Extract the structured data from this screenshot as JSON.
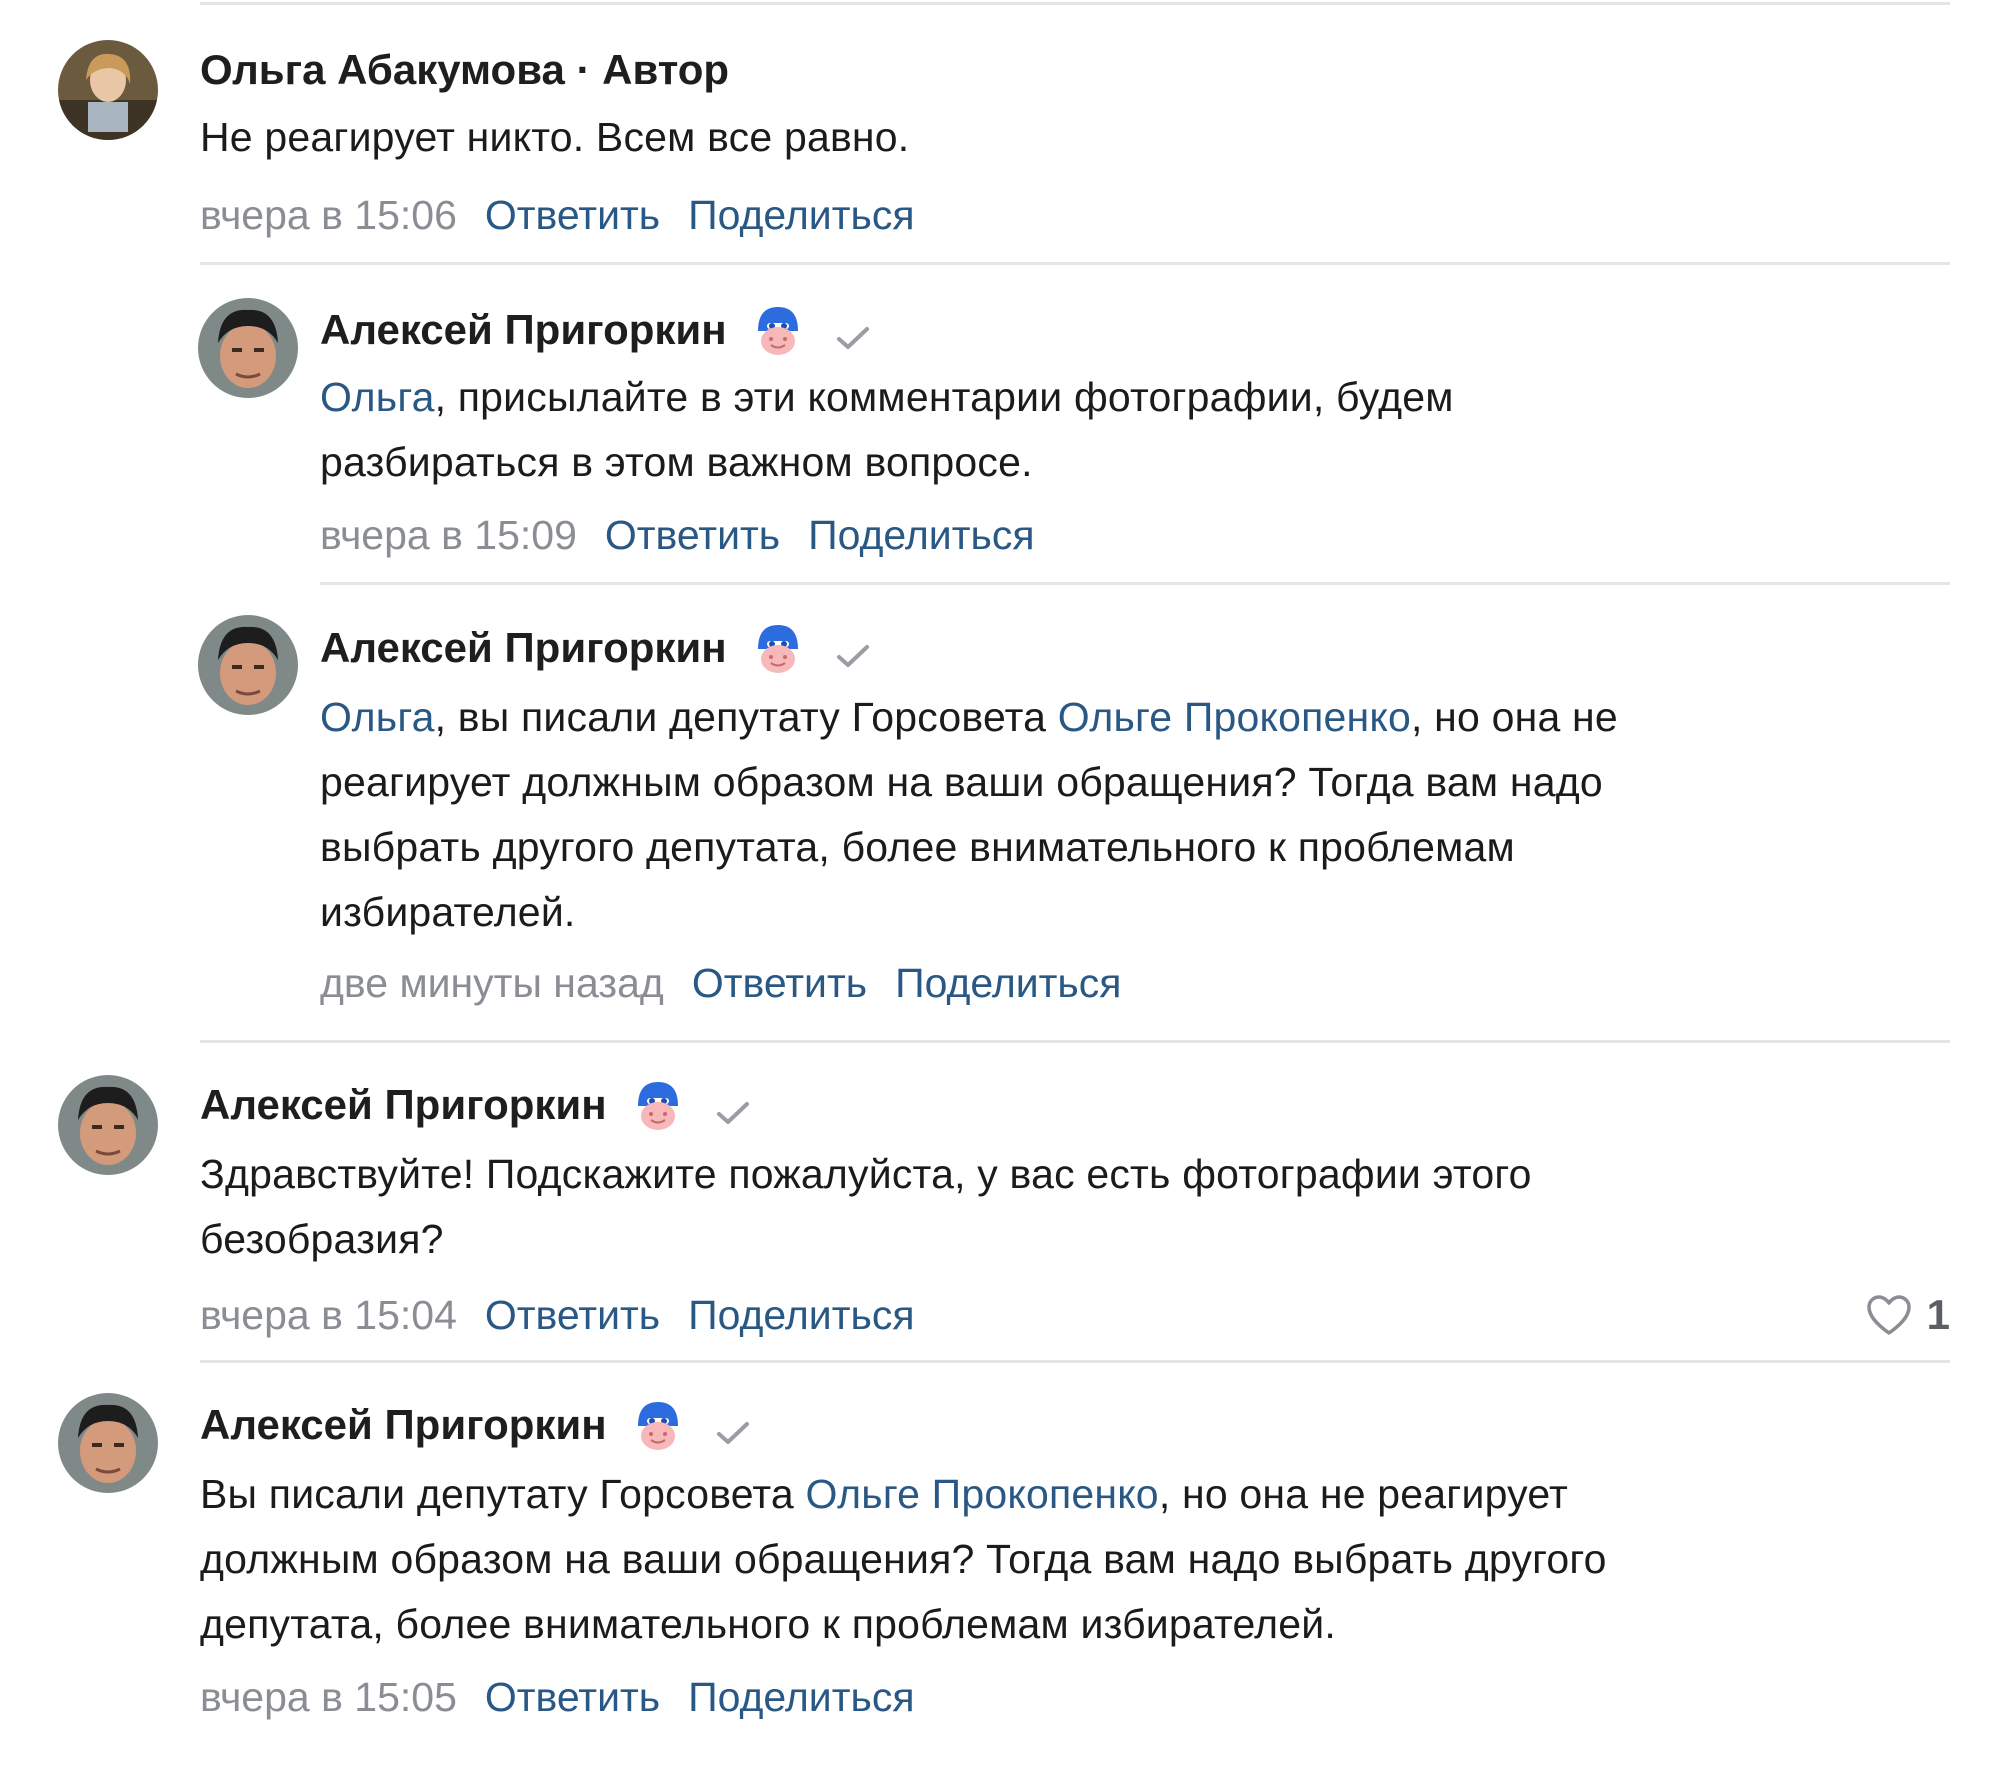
{
  "comments": [
    {
      "author": "Ольга Абакумова · Автор",
      "text_parts": [
        "Не реагирует никто. Всем все равно."
      ],
      "time": "вчера в 15:06",
      "reply_label": "Ответить",
      "share_label": "Поделиться"
    },
    {
      "author": "Алексей Пригоркин",
      "mention_1": "Ольга",
      "text_1": ", присылайте в эти комментарии фотографии, будем",
      "text_2": "разбираться в этом важном вопросе.",
      "time": "вчера в 15:09",
      "reply_label": "Ответить",
      "share_label": "Поделиться"
    },
    {
      "author": "Алексей Пригоркин",
      "mention_1": "Ольга",
      "text_1": ", вы писали депутату Горсовета ",
      "mention_2": "Ольге Прокопенко",
      "text_2": ", но она не",
      "text_3": "реагирует должным образом на ваши обращения? Тогда вам надо",
      "text_4": "выбрать другого депутата, более внимательного к проблемам",
      "text_5": "избирателей.",
      "time": "две минуты назад",
      "reply_label": "Ответить",
      "share_label": "Поделиться"
    },
    {
      "author": "Алексей Пригоркин",
      "text_1": "Здравствуйте! Подскажите пожалуйста, у вас есть фотографии этого",
      "text_2": "безобразия?",
      "time": "вчера в 15:04",
      "reply_label": "Ответить",
      "share_label": "Поделиться",
      "likes": "1"
    },
    {
      "author": "Алексей Пригоркин",
      "text_1": "Вы писали депутату Горсовета ",
      "mention_1": "Ольге Прокопенко",
      "text_2": ", но она не реагирует",
      "text_3": "должным образом на ваши обращения? Тогда вам надо выбрать другого",
      "text_4": "депутата, более внимательного к проблемам избирателей.",
      "time": "вчера в 15:05",
      "reply_label": "Ответить",
      "share_label": "Поделиться"
    }
  ],
  "colors": {
    "link": "#2a5885",
    "meta": "#8a8d93",
    "separator": "#e3e5e8",
    "badge_blue": "#2d6cdf"
  },
  "icons": {
    "badge": "prometheus-badge-icon",
    "check": "verified-check-icon",
    "like": "heart-icon"
  }
}
